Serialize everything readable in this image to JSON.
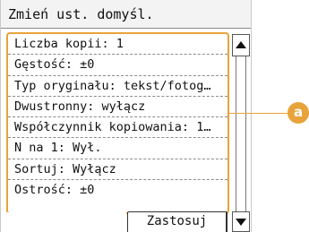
{
  "title": "Zmień ust. domyśl.",
  "settings": [
    "Liczba kopii:  1",
    "Gęstość: ±0",
    "Typ oryginału: tekst/fotog…",
    "Dwustronny: wyłącz",
    "Współczynnik kopiowania: 1…",
    "N na 1: Wył.",
    "Sortuj: Wyłącz",
    "Ostrość: ±0"
  ],
  "apply_label": "Zastosuj",
  "callout_label": "a",
  "colors": {
    "highlight": "#e8a33a"
  }
}
